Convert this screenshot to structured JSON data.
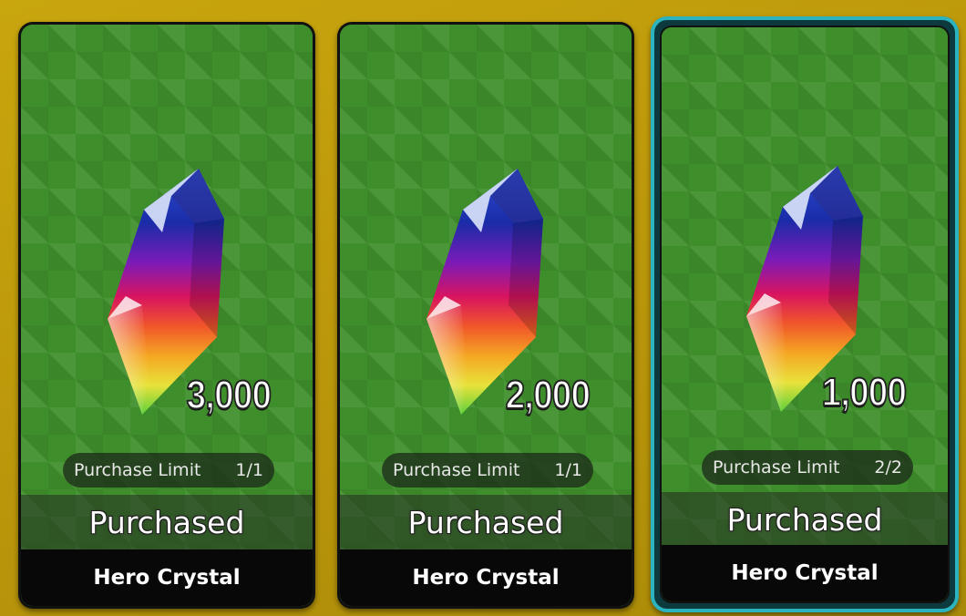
{
  "shop_items": [
    {
      "price": "3,000",
      "limit_label": "Purchase Limit",
      "limit_value": "1/1",
      "status": "Purchased",
      "name": "Hero Crystal"
    },
    {
      "price": "2,000",
      "limit_label": "Purchase Limit",
      "limit_value": "1/1",
      "status": "Purchased",
      "name": "Hero Crystal"
    },
    {
      "price": "1,000",
      "limit_label": "Purchase Limit",
      "limit_value": "2/2",
      "status": "Purchased",
      "name": "Hero Crystal"
    }
  ],
  "selected_index": 2,
  "icons": {
    "item": "rainbow-crystal-icon"
  },
  "colors": {
    "background": "#c9a60e",
    "card_green": "#3e8e2b",
    "selected_border": "#2bb3bf",
    "name_band": "#080808"
  }
}
